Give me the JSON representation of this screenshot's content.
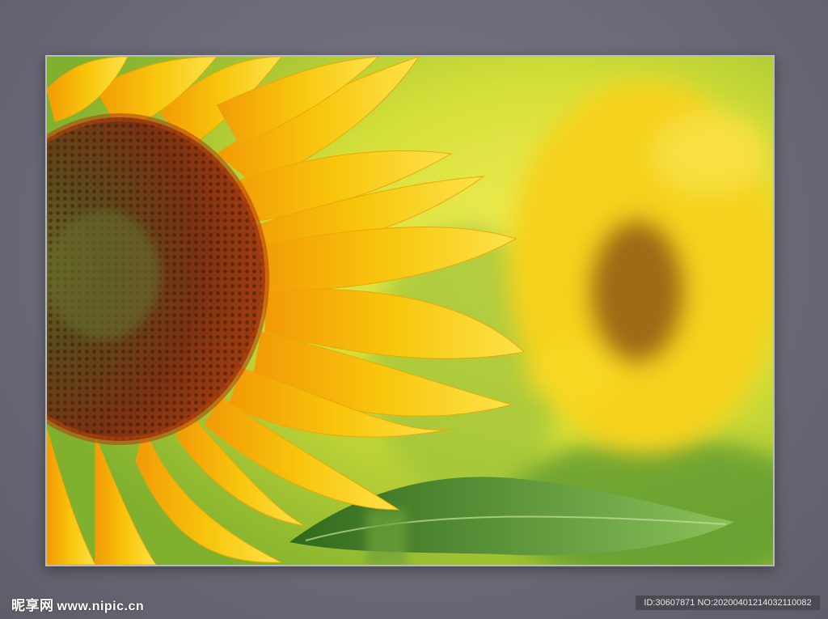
{
  "watermark": {
    "logo_text": "昵享网",
    "url": "www.nipic.cn",
    "id_line": "ID:30607871 NO:20200401214032110082"
  },
  "colors": {
    "background": "#6b6b77",
    "petal": "#f7c90c",
    "center": "#7a3a10",
    "leaf": "#4e8a2c"
  },
  "scene": {
    "subject": "sunflower-closeup",
    "background_subject": "blurred-sunflower"
  }
}
